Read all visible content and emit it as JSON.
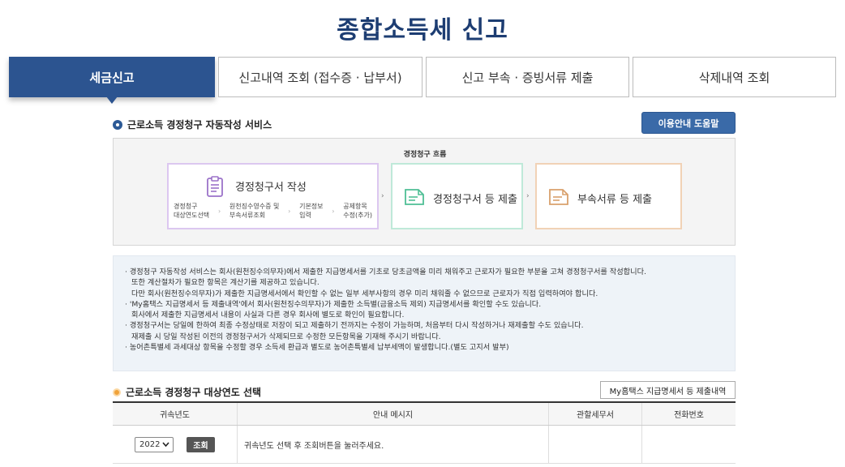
{
  "page_title": "종합소득세 신고",
  "tabs": [
    {
      "label": "세금신고",
      "active": true
    },
    {
      "label": "신고내역 조회 (접수증 · 납부서)",
      "active": false
    },
    {
      "label": "신고 부속 · 증빙서류 제출",
      "active": false
    },
    {
      "label": "삭제내역 조회",
      "active": false
    }
  ],
  "service": {
    "title": "근로소득 경정청구 자동작성 서비스",
    "help_button": "이용안내 도움말"
  },
  "flow": {
    "title": "경정청구 흐름",
    "step1": {
      "label": "경정청구서 작성",
      "icon": "clipboard-icon",
      "substeps": [
        [
          "경정청구",
          "대상연도선택"
        ],
        [
          "원천징수영수증 및",
          "부속서류조회"
        ],
        [
          "기본정보",
          "입력"
        ],
        [
          "공제항목",
          "수정(추가)"
        ]
      ]
    },
    "step2": {
      "label": "경정청구서 등 제출",
      "icon": "document-icon"
    },
    "step3": {
      "label": "부속서류 등 제출",
      "icon": "document-icon"
    },
    "colors": {
      "step1_border": "#dcc7f0",
      "step2_border": "#bfe9d9",
      "step3_border": "#f1d2b6"
    }
  },
  "notice": {
    "lines": [
      "경정청구 자동작성 서비스는 회사(원천징수의무자)에서 제출한 지급명세서를 기초로 당초금액을 미리 채워주고 근로자가 필요한 부분을 고쳐 경정청구서를 작성합니다.",
      "또한 계산절차가 필요한 항목은 계산기를 제공하고 있습니다.",
      "다만 회사(원천징수의무자)가 제출한 지급명세서에서 확인할 수 없는 일부 세부사항의 경우 미리 채워줄 수 없으므로 근로자가 직접 입력하여야 합니다.",
      "'My홈택스 지급명세서 등 제출내역'에서 회사(원천징수의무자)가 제출한 소득별(금융소득 제외) 지급명세서를 확인할 수도 있습니다.",
      "회사에서 제출한 지급명세서 내용이 사실과 다른 경우 회사에 별도로 확인이 필요합니다.",
      "경정청구서는 당일에 한하여 최종 수정상태로 저장이 되고 제출하기 전까지는 수정이 가능하며, 처음부터 다시 작성하거나 재제출할 수도 있습니다.",
      "재제출 시 당일 작성된 이전의 경정청구서가 삭제되므로 수정한 모든항목을 기재해 주시기 바랍니다.",
      "농어촌특별세 과세대상 항목을 수정할 경우 소득세 환급과 별도로 농어촌특별세 납부세액이 발생합니다.(별도 고지서 발부)"
    ]
  },
  "year_section": {
    "title": "근로소득 경정청구 대상연도 선택",
    "history_button": "My홈택스 지급명세서 등 제출내역",
    "columns": [
      "귀속년도",
      "안내 메시지",
      "관할세무서",
      "전화번호"
    ],
    "row": {
      "year": "2022",
      "search_label": "조회",
      "message": "귀속년도 선택 후 조회버튼을 눌러주세요.",
      "tax_office": "",
      "phone": ""
    }
  },
  "accent_colors": {
    "primary": "#2c5490",
    "title": "#1d3d72",
    "orange": "#f0a23a"
  }
}
